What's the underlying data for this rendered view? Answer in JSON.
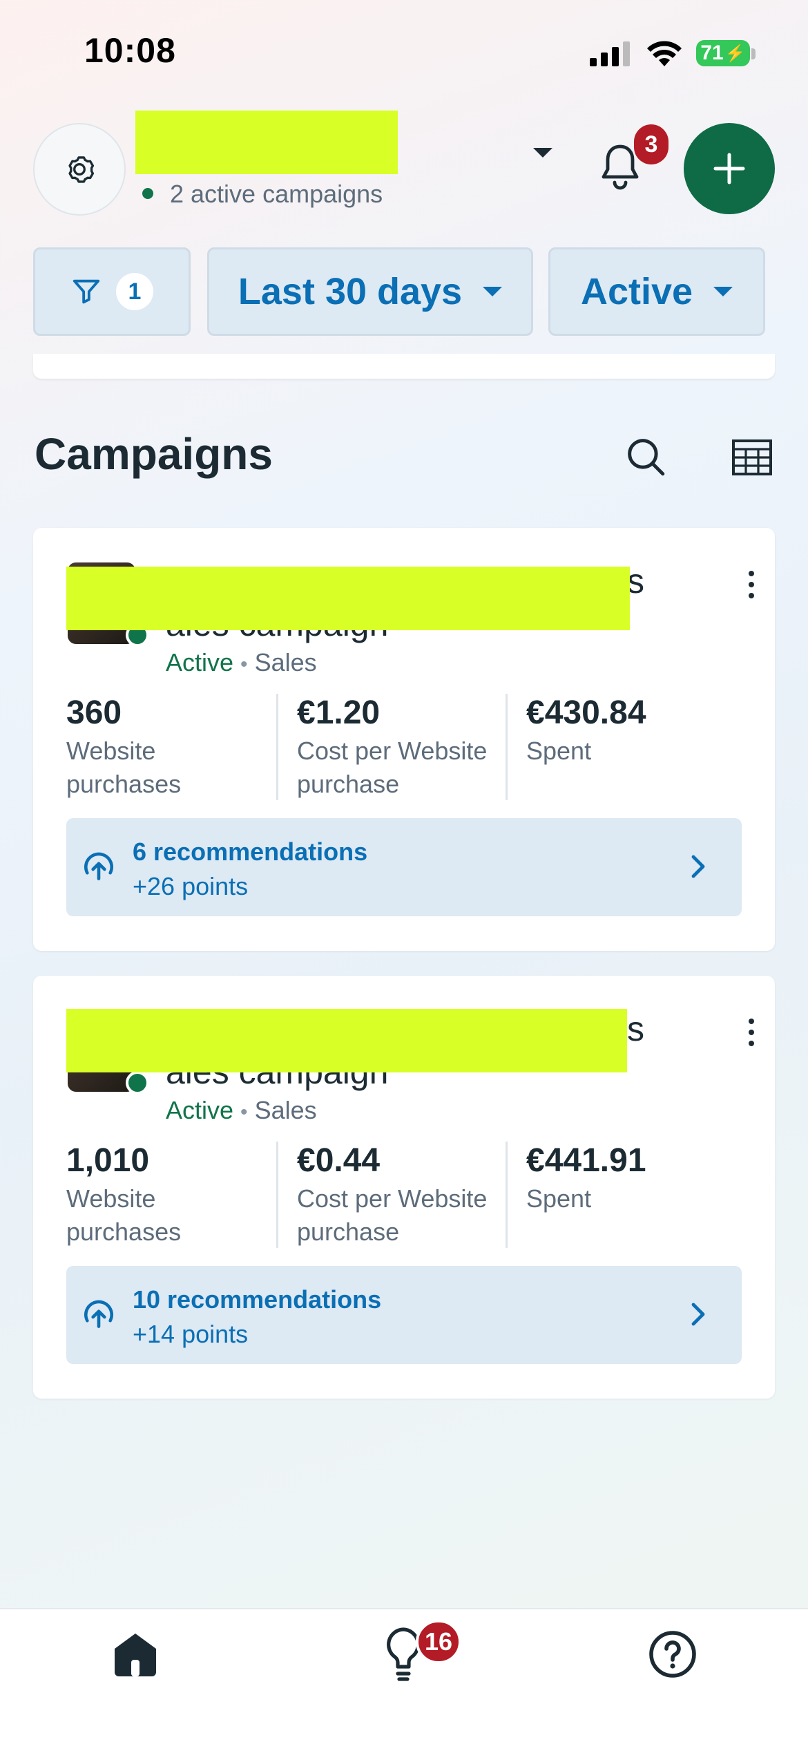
{
  "status_bar": {
    "time": "10:08",
    "battery": "71"
  },
  "header": {
    "account_subtitle": "2 active campaigns",
    "notifications_count": "3"
  },
  "filters": {
    "filter_count": "1",
    "date_range": "Last 30 days",
    "status": "Active"
  },
  "section": {
    "title": "Campaigns"
  },
  "campaigns": [
    {
      "name_visible_fragment": "ales campaign",
      "name_trailing_char": "s",
      "status": "Active",
      "objective": "Sales",
      "metrics": [
        {
          "value": "360",
          "label": "Website purchases"
        },
        {
          "value": "€1.20",
          "label": "Cost per Website purchase"
        },
        {
          "value": "€430.84",
          "label": "Spent"
        }
      ],
      "recommendations": {
        "title": "6 recommendations",
        "points": "+26 points"
      }
    },
    {
      "name_visible_fragment": "ales campaign",
      "name_trailing_char": "s",
      "status": "Active",
      "objective": "Sales",
      "metrics": [
        {
          "value": "1,010",
          "label": "Website purchases"
        },
        {
          "value": "€0.44",
          "label": "Cost per Website purchase"
        },
        {
          "value": "€441.91",
          "label": "Spent"
        }
      ],
      "recommendations": {
        "title": "10 recommendations",
        "points": "+14 points"
      }
    }
  ],
  "bottom_nav": {
    "ideas_badge": "16"
  },
  "colors": {
    "accent_blue": "#0a6fb4",
    "active_green": "#10744b",
    "badge_red": "#b31b26",
    "redaction": "#d8ff26"
  }
}
